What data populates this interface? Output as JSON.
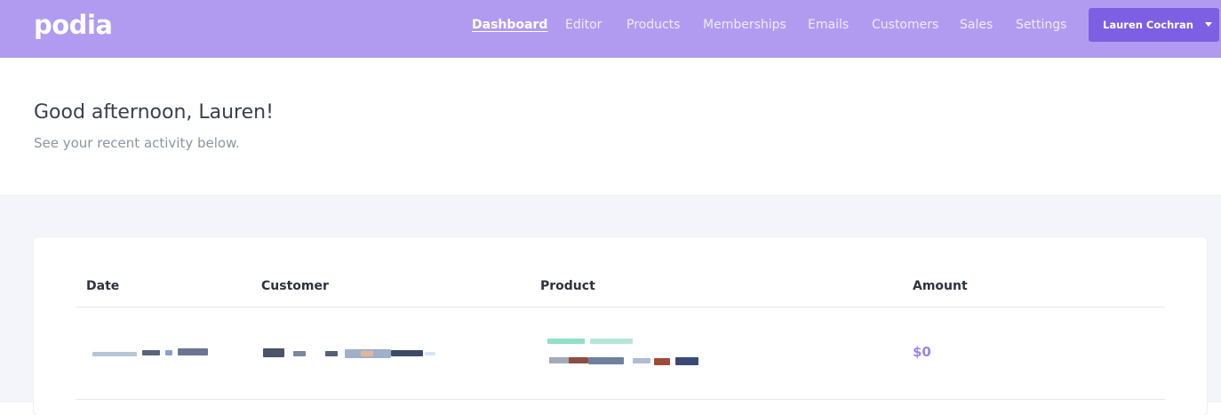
{
  "brand": {
    "logo_text": "podia"
  },
  "nav": {
    "items": [
      {
        "label": "Dashboard",
        "active": true
      },
      {
        "label": "Editor"
      },
      {
        "label": "Products"
      },
      {
        "label": "Memberships"
      },
      {
        "label": "Emails"
      },
      {
        "label": "Customers"
      },
      {
        "label": "Sales"
      },
      {
        "label": "Settings"
      }
    ]
  },
  "user": {
    "name": "Lauren Cochran"
  },
  "page": {
    "greeting": "Good afternoon, Lauren!",
    "subtitle": "See your recent activity below."
  },
  "activity_table": {
    "columns": [
      "Date",
      "Customer",
      "Product",
      "Amount"
    ],
    "rows": [
      {
        "date": "",
        "customer": "",
        "product": "",
        "amount": "$0"
      }
    ]
  },
  "colors": {
    "topbar": "#b19bf0",
    "user_button": "#7d5fe4",
    "amount": "#9a86e6",
    "content_bg": "#f4f5fa"
  }
}
